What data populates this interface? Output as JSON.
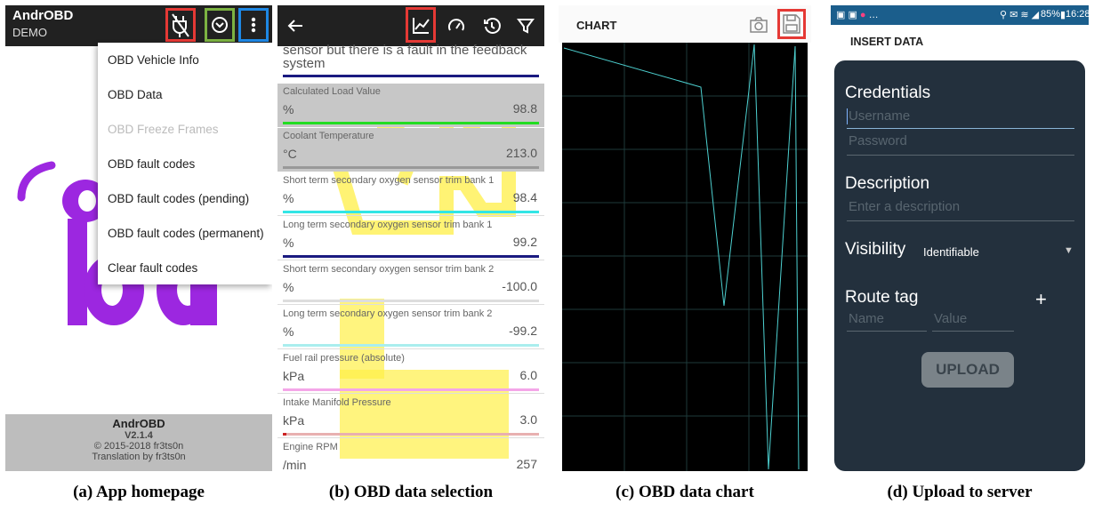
{
  "panel_a": {
    "app_title": "AndrOBD",
    "app_subtitle": "DEMO",
    "menu": [
      {
        "label": "OBD Vehicle Info",
        "enabled": true
      },
      {
        "label": "OBD Data",
        "enabled": true
      },
      {
        "label": "OBD Freeze Frames",
        "enabled": false
      },
      {
        "label": "OBD fault codes",
        "enabled": true
      },
      {
        "label": "OBD fault codes (pending)",
        "enabled": true
      },
      {
        "label": "OBD fault codes (permanent)",
        "enabled": true
      },
      {
        "label": "Clear fault codes",
        "enabled": true
      }
    ],
    "about": {
      "name": "AndrOBD",
      "version": "V2.1.4",
      "copyright": "© 2015-2018 fr3ts0n",
      "translation": "Translation by fr3ts0n"
    },
    "caption": "(a) App homepage"
  },
  "panel_b": {
    "partial_text": "sensor but there is a fault in the feedback",
    "partial_text2": "system",
    "rows": [
      {
        "name": "Calculated Load Value",
        "unit": "%",
        "value": "98.8",
        "line": "#22dd22",
        "selected": true
      },
      {
        "name": "Coolant Temperature",
        "unit": "°C",
        "value": "213.0",
        "line": "#999999",
        "selected": true
      },
      {
        "name": "Short term secondary oxygen sensor trim bank 1",
        "unit": "%",
        "value": "98.4",
        "line": "#33e6e6",
        "selected": false
      },
      {
        "name": "Long term secondary oxygen sensor trim bank 1",
        "unit": "%",
        "value": "99.2",
        "line": "#1a1a80",
        "selected": false
      },
      {
        "name": "Short term secondary oxygen sensor trim bank 2",
        "unit": "%",
        "value": "-100.0",
        "line": "#dddddd",
        "selected": false
      },
      {
        "name": "Long term secondary oxygen sensor trim bank 2",
        "unit": "%",
        "value": "-99.2",
        "line": "#aaeeee",
        "selected": false
      },
      {
        "name": "Fuel rail pressure (absolute)",
        "unit": "kPa",
        "value": "6.0",
        "line": "#f4a6e8",
        "selected": false
      },
      {
        "name": "Intake Manifold Pressure",
        "unit": "kPa",
        "value": "3.0",
        "line": "#e8b0b0",
        "selected": false
      },
      {
        "name": "Engine RPM",
        "unit": "/min",
        "value": "257",
        "line": "#ffffff",
        "selected": false
      }
    ],
    "caption": "(b) OBD data selection"
  },
  "panel_c": {
    "title": "CHART",
    "line_color": "#4dd0d0",
    "caption": "(c) OBD data chart"
  },
  "panel_d": {
    "status_time": "16:28",
    "status_battery": "85%",
    "title": "INSERT DATA",
    "credentials_label": "Credentials",
    "username_placeholder": "Username",
    "password_placeholder": "Password",
    "description_label": "Description",
    "description_placeholder": "Enter a description",
    "visibility_label": "Visibility",
    "visibility_value": "Identifiable",
    "route_tag_label": "Route tag",
    "route_name_placeholder": "Name",
    "route_value_placeholder": "Value",
    "upload_label": "UPLOAD",
    "caption": "(d) Upload to server"
  }
}
